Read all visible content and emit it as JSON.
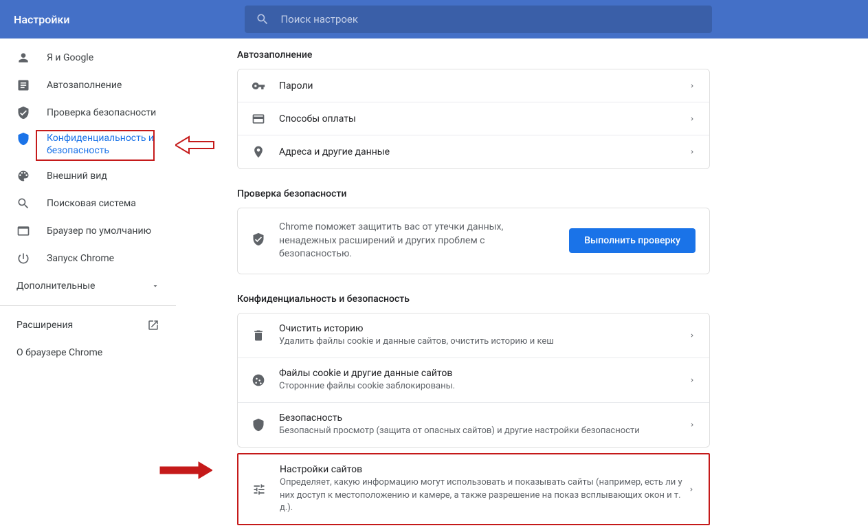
{
  "header": {
    "title": "Настройки",
    "search_placeholder": "Поиск настроек"
  },
  "nav": {
    "items": [
      {
        "label": "Я и Google"
      },
      {
        "label": "Автозаполнение"
      },
      {
        "label": "Проверка безопасности"
      },
      {
        "label": "Конфиденциальность и безопасность"
      },
      {
        "label": "Внешний вид"
      },
      {
        "label": "Поисковая система"
      },
      {
        "label": "Браузер по умолчанию"
      },
      {
        "label": "Запуск Chrome"
      }
    ],
    "advanced": "Дополнительные",
    "extensions": "Расширения",
    "about": "О браузере Chrome"
  },
  "autofill": {
    "title": "Автозаполнение",
    "rows": [
      {
        "label": "Пароли"
      },
      {
        "label": "Способы оплаты"
      },
      {
        "label": "Адреса и другие данные"
      }
    ]
  },
  "safety": {
    "title": "Проверка безопасности",
    "text": "Chrome поможет защитить вас от утечки данных, ненадежных расширений и других проблем с безопасностью.",
    "button": "Выполнить проверку"
  },
  "privacy": {
    "title": "Конфиденциальность и безопасность",
    "rows": [
      {
        "title": "Очистить историю",
        "sub": "Удалить файлы cookie и данные сайтов, очистить историю и кеш"
      },
      {
        "title": "Файлы cookie и другие данные сайтов",
        "sub": "Сторонние файлы cookie заблокированы."
      },
      {
        "title": "Безопасность",
        "sub": "Безопасный просмотр (защита от опасных сайтов) и другие настройки безопасности"
      },
      {
        "title": "Настройки сайтов",
        "sub": "Определяет, какую информацию могут использовать и показывать сайты (например, есть ли у них доступ к местоположению и камере, а также разрешение на показ всплывающих окон и т. д.)."
      }
    ]
  }
}
